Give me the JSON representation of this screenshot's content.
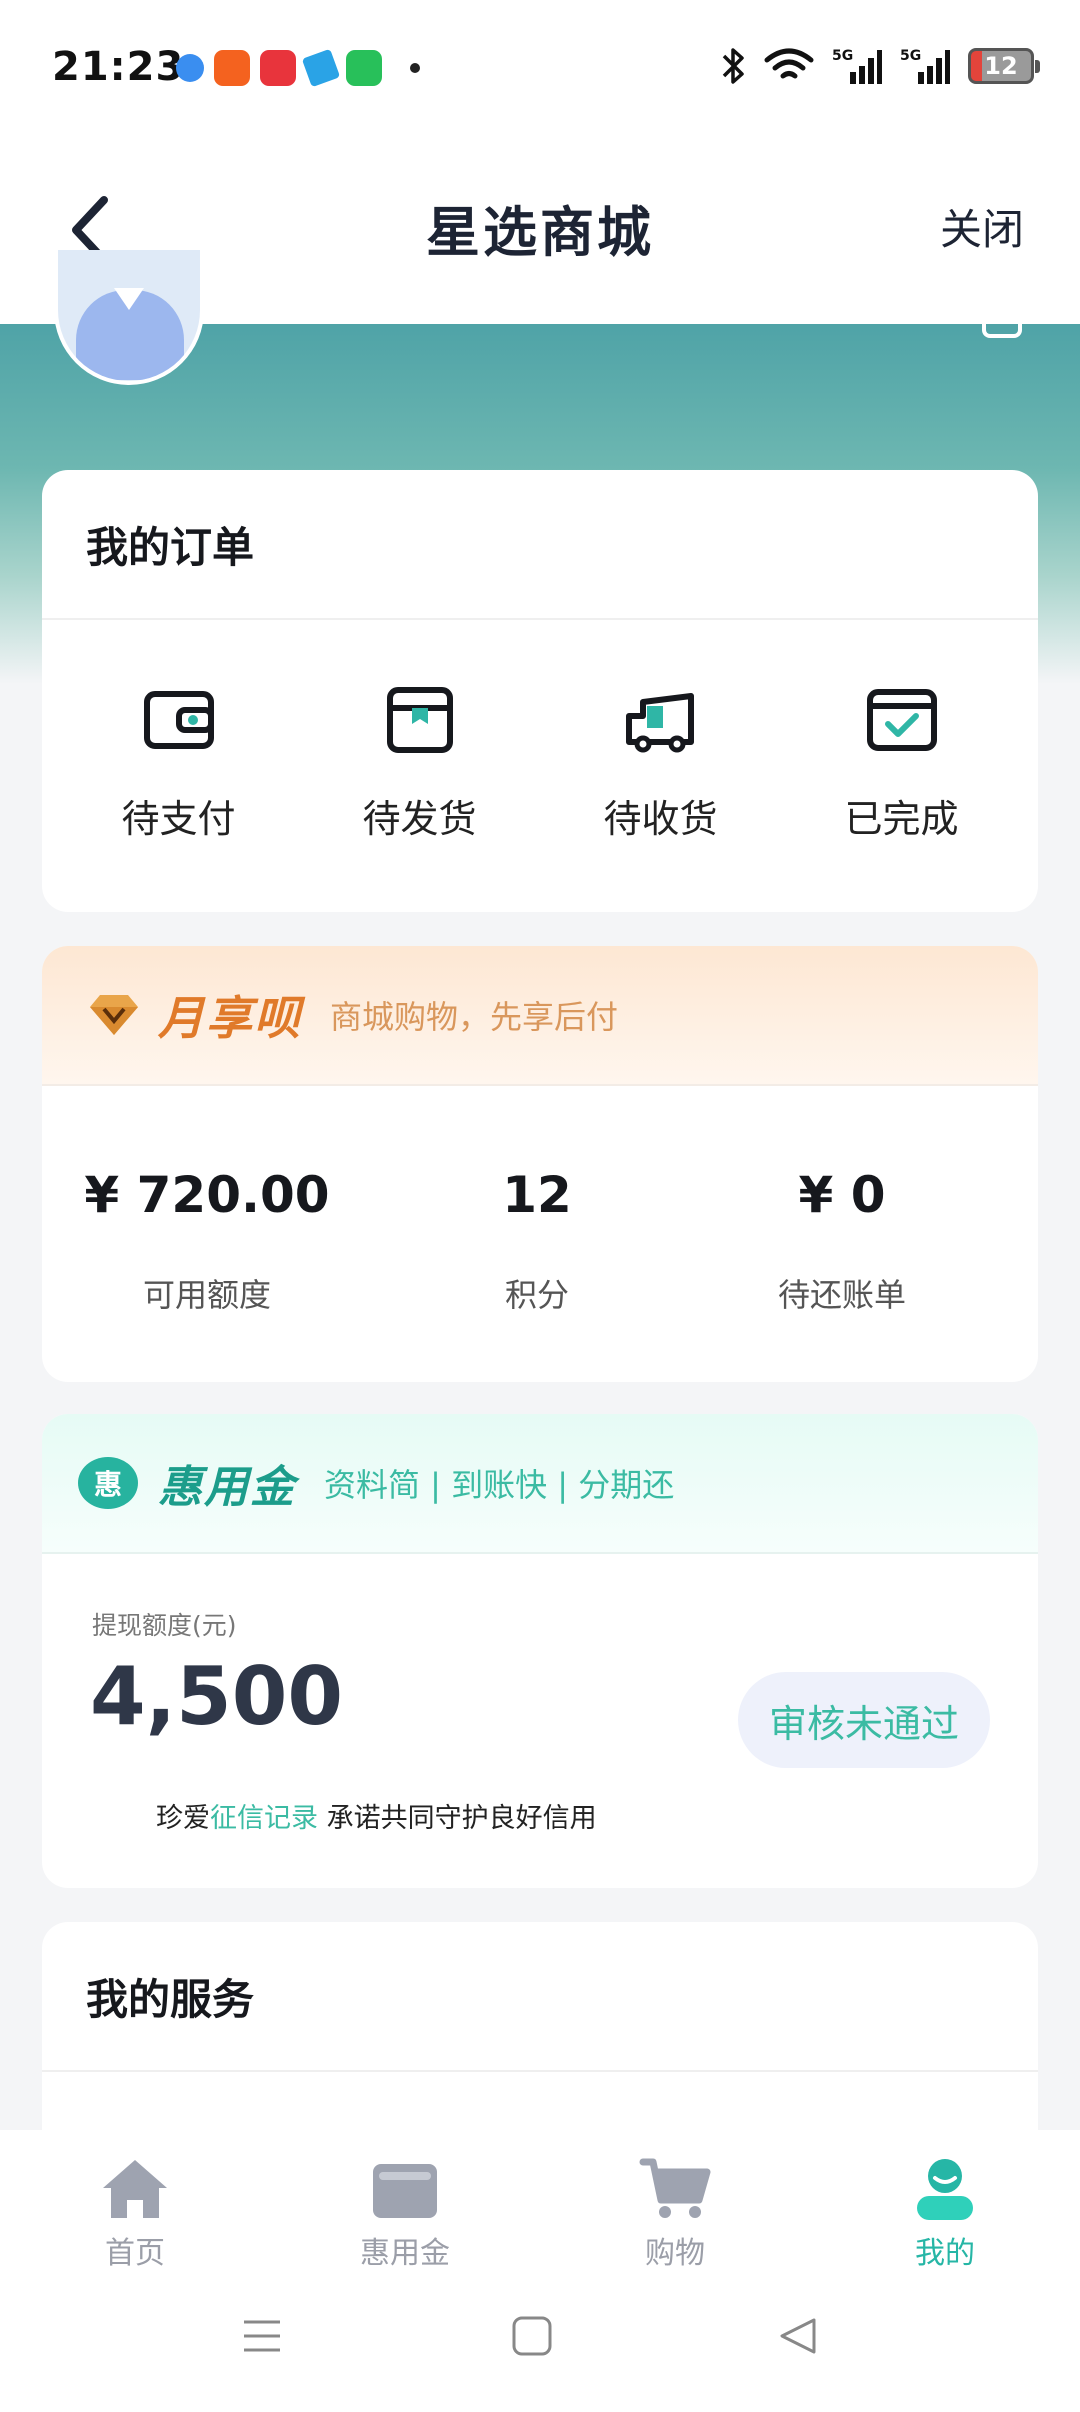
{
  "status_bar": {
    "time": "21:23",
    "battery": "12"
  },
  "header": {
    "title": "星选商城",
    "close_label": "关闭"
  },
  "orders": {
    "title": "我的订单",
    "items": [
      {
        "label": "待支付",
        "icon": "wallet-icon"
      },
      {
        "label": "待发货",
        "icon": "box-icon"
      },
      {
        "label": "待收货",
        "icon": "truck-icon"
      },
      {
        "label": "已完成",
        "icon": "check-box-icon"
      }
    ]
  },
  "monthly": {
    "brand": "月享呗",
    "slogan": "商城购物，先享后付",
    "stats": [
      {
        "value": "¥ 720.00",
        "label": "可用额度"
      },
      {
        "value": "12",
        "label": "积分"
      },
      {
        "value": "¥ 0",
        "label": "待还账单"
      }
    ]
  },
  "hyj": {
    "logo_char": "惠",
    "brand": "惠用金",
    "slogan": "资料简 | 到账快 | 分期还",
    "quota_label": "提现额度(元)",
    "quota_value": "4,500",
    "status": "审核未通过",
    "note_prefix": "珍爱",
    "note_link": "征信记录",
    "note_suffix": "承诺共同守护良好信用"
  },
  "services": {
    "title": "我的服务"
  },
  "tabbar": [
    {
      "label": "首页",
      "icon": "home-icon",
      "active": false
    },
    {
      "label": "惠用金",
      "icon": "wallet-icon",
      "active": false
    },
    {
      "label": "购物",
      "icon": "cart-icon",
      "active": false
    },
    {
      "label": "我的",
      "icon": "profile-icon",
      "active": true
    }
  ],
  "colors": {
    "accent": "#26b6a6",
    "monthly_brand": "#e07a2a",
    "header_text": "#1d2434"
  }
}
